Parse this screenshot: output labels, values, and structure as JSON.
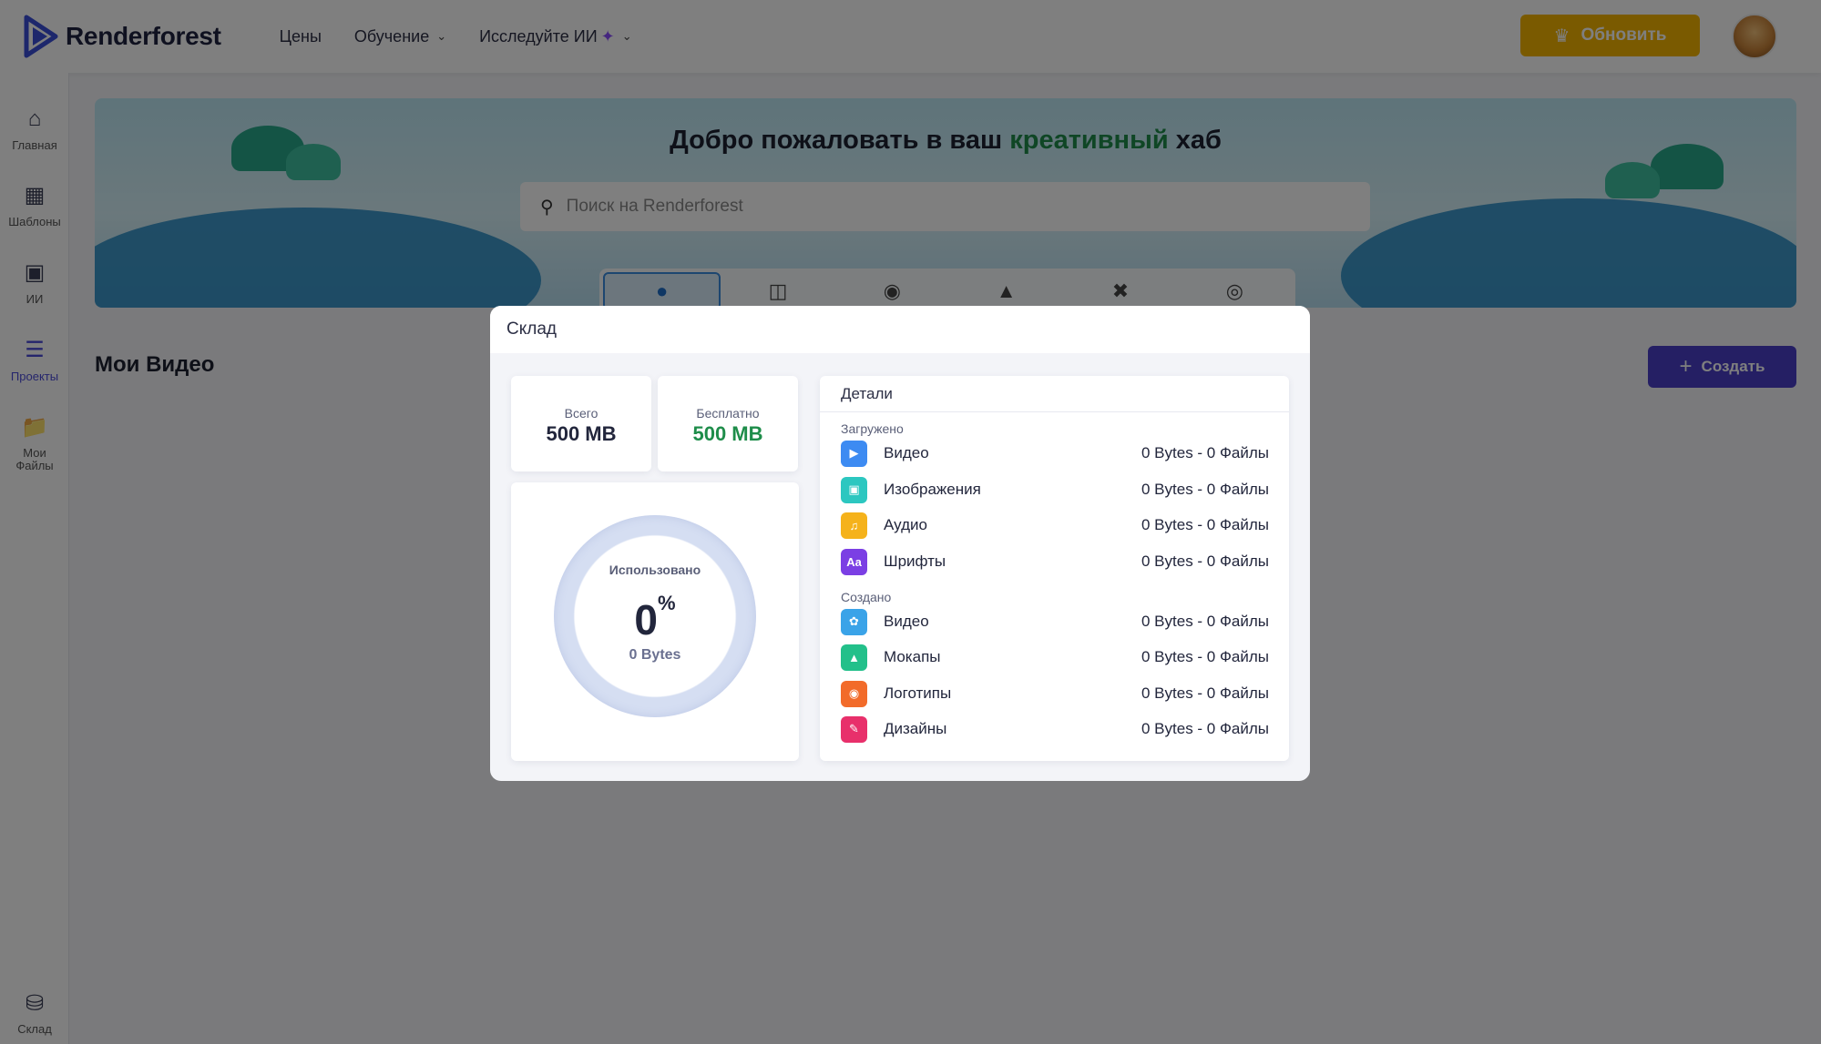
{
  "header": {
    "brand": "Renderforest",
    "nav": [
      {
        "label": "Цены",
        "has_chevron": false
      },
      {
        "label": "Обучение",
        "has_chevron": true
      },
      {
        "label": "Исследуйте ИИ",
        "has_chevron": true
      }
    ],
    "upgrade_label": "Обновить"
  },
  "sidebar": {
    "items": [
      {
        "label": "Главная",
        "icon": "home-icon"
      },
      {
        "label": "Шаблоны",
        "icon": "templates-icon"
      },
      {
        "label": "ИИ",
        "icon": "ai-icon"
      },
      {
        "label": "Проекты",
        "icon": "layers-icon",
        "active": true
      },
      {
        "label": "Мои Файлы",
        "icon": "folder-icon"
      }
    ],
    "storage_label": "Склад"
  },
  "banner": {
    "title_before": "Добро пожаловать в ваш ",
    "title_highlight": "креативный",
    "title_after": " хаб",
    "search_placeholder": "Поиск на Renderforest",
    "category_tabs": [
      "video-camera-icon",
      "website-code-icon",
      "acorn-logo-icon",
      "tshirt-mockup-icon",
      "design-tools-icon",
      "globe-icon"
    ]
  },
  "main": {
    "title": "Мои Видео",
    "create_label": "Создать"
  },
  "modal": {
    "title": "Склад",
    "total_label": "Всего",
    "total_value": "500 MB",
    "free_label": "Бесплатно",
    "free_value": "500 MB",
    "used_label": "Использовано",
    "used_percent": "0",
    "used_percent_sign": "%",
    "used_bytes": "0 Bytes",
    "details_title": "Детали",
    "uploaded_label": "Загружено",
    "uploaded": [
      {
        "name": "Видео",
        "value": "0 Bytes - 0 Файлы",
        "icon": "video-camera-icon",
        "color": "#3d8bf2"
      },
      {
        "name": "Изображения",
        "value": "0 Bytes - 0 Файлы",
        "icon": "image-icon",
        "color": "#2cc7c0"
      },
      {
        "name": "Аудио",
        "value": "0 Bytes - 0 Файлы",
        "icon": "music-note-icon",
        "color": "#f5b21b"
      },
      {
        "name": "Шрифты",
        "value": "0 Bytes - 0 Файлы",
        "icon": "font-icon",
        "color": "#7b3fe4"
      }
    ],
    "created_label": "Создано",
    "created": [
      {
        "name": "Видео",
        "value": "0 Bytes - 0 Файлы",
        "icon": "film-reel-icon",
        "color": "#3aa3e8"
      },
      {
        "name": "Мокапы",
        "value": "0 Bytes - 0 Файлы",
        "icon": "tshirt-icon",
        "color": "#23c08a"
      },
      {
        "name": "Логотипы",
        "value": "0 Bytes - 0 Файлы",
        "icon": "acorn-icon",
        "color": "#f26b2a"
      },
      {
        "name": "Дизайны",
        "value": "0 Bytes - 0 Файлы",
        "icon": "design-icon",
        "color": "#e8306b"
      }
    ]
  }
}
